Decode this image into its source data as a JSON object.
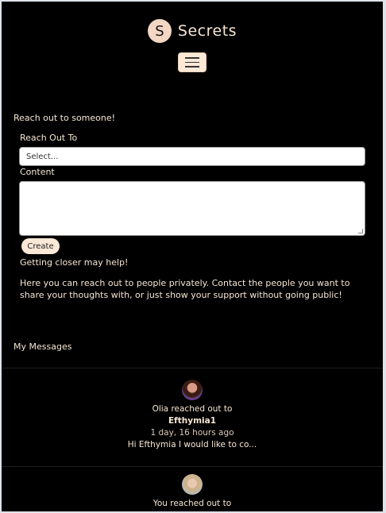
{
  "brand": {
    "logo_letter": "S",
    "name": "Secrets"
  },
  "form": {
    "title": "Reach out to someone!",
    "recipient_label": "Reach Out To",
    "recipient_value": "Select...",
    "content_label": "Content",
    "create_label": "Create",
    "hint": "Getting closer may help!",
    "info": "Here you can reach out to people privately. Contact the people you want to share your thoughts with, or just show your support without going public!"
  },
  "messages": {
    "title": "My Messages",
    "items": [
      {
        "sender_line": "Olia reached out to",
        "recipient": "Efthymia1",
        "time": "1 day, 16 hours ago",
        "preview": "Hi Efthymia I would like to co..."
      },
      {
        "sender_line": "You reached out to"
      }
    ]
  },
  "colors": {
    "background": "#000000",
    "accent": "#fbe8d6",
    "text": "#f6e6d4"
  }
}
